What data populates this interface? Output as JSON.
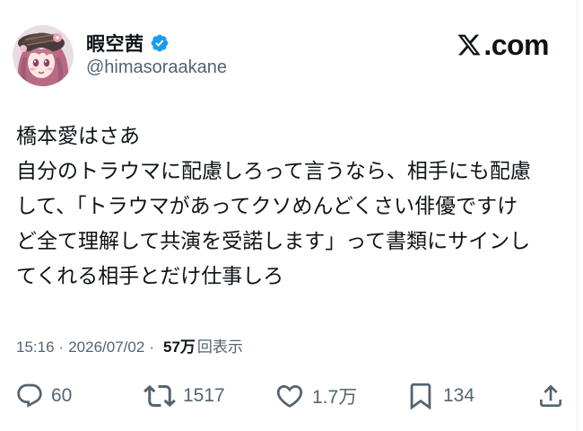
{
  "account": {
    "display_name": "暇空茜",
    "handle": "@himasoraakane",
    "verified": true
  },
  "brand": {
    "logo_text": ".com",
    "logo_icon": "x-logo-icon"
  },
  "tweet": {
    "lines": [
      "橋本愛はさあ",
      "自分のトラウマに配慮しろって言うなら、相手にも配慮",
      "して、「トラウマがあってクソめんどくさい俳優ですけ",
      "ど全て理解して共演を受諾します」って書類にサインし",
      "てくれる相手とだけ仕事しろ"
    ]
  },
  "meta": {
    "time": "15:16",
    "separator": "·",
    "date": "2026/07/02",
    "views_count": "57万",
    "views_label": "回表示"
  },
  "actions": {
    "reply_count": "60",
    "retweet_count": "1517",
    "like_count": "1.7万",
    "bookmark_count": "134"
  },
  "colors": {
    "text_primary": "#0f1419",
    "text_secondary": "#536471",
    "verified_blue": "#1d9bf0"
  }
}
